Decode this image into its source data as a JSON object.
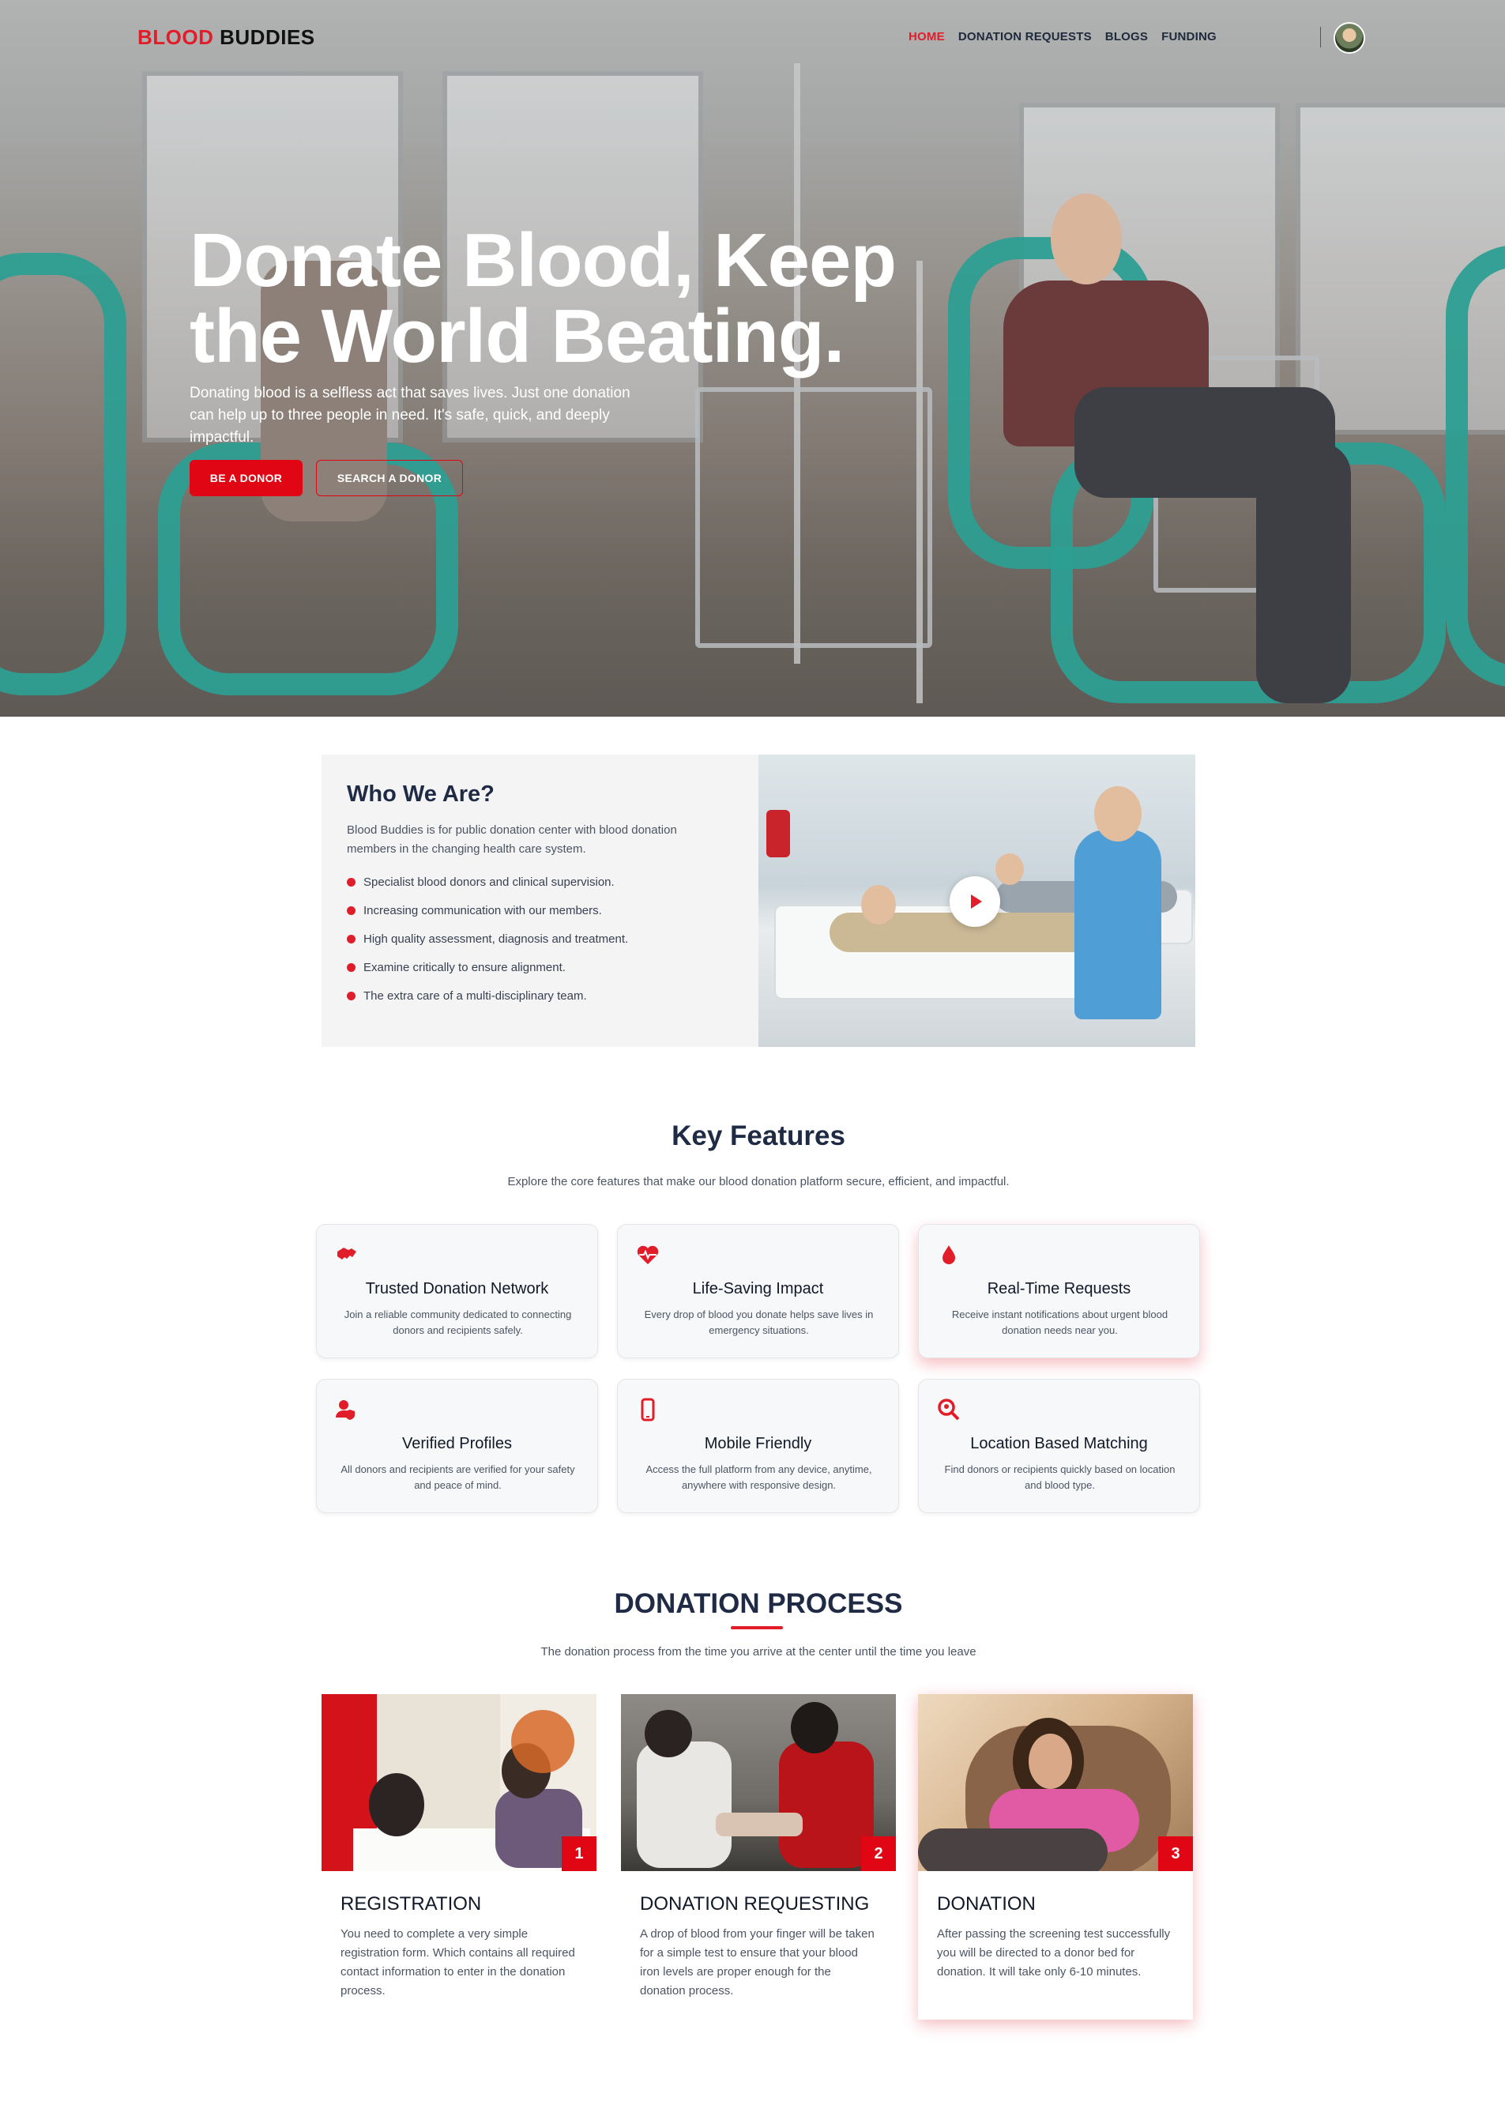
{
  "brand": {
    "part1": "BLOOD",
    "part2": "BUDDIES"
  },
  "nav": {
    "items": [
      "HOME",
      "DONATION REQUESTS",
      "BLOGS",
      "FUNDING"
    ],
    "active": "HOME"
  },
  "hero": {
    "title": "Donate Blood, Keep the World Beating.",
    "subtitle": "Donating blood is a selfless act that saves lives. Just one donation can help up to three people in need. It's safe, quick, and deeply impactful.",
    "primary_button": "BE A DONOR",
    "secondary_button": "SEARCH A DONOR"
  },
  "who": {
    "title": "Who We Are?",
    "description": "Blood Buddies is for public donation center with blood donation members in the changing health care system.",
    "points": [
      "Specialist blood donors and clinical supervision.",
      "Increasing communication with our members.",
      "High quality assessment, diagnosis and treatment.",
      "Examine critically to ensure alignment.",
      "The extra care of a multi-disciplinary team."
    ]
  },
  "features": {
    "title": "Key Features",
    "subtitle": "Explore the core features that make our blood donation platform secure, efficient, and impactful.",
    "cards": [
      {
        "icon": "handshake-icon",
        "title": "Trusted Donation Network",
        "desc": "Join a reliable community dedicated to connecting donors and recipients safely."
      },
      {
        "icon": "heartbeat-icon",
        "title": "Life-Saving Impact",
        "desc": "Every drop of blood you donate helps save lives in emergency situations."
      },
      {
        "icon": "blood-drop-icon",
        "title": "Real-Time Requests",
        "desc": "Receive instant notifications about urgent blood donation needs near you."
      },
      {
        "icon": "user-shield-icon",
        "title": "Verified Profiles",
        "desc": "All donors and recipients are verified for your safety and peace of mind."
      },
      {
        "icon": "mobile-icon",
        "title": "Mobile Friendly",
        "desc": "Access the full platform from any device, anytime, anywhere with responsive design."
      },
      {
        "icon": "search-location-icon",
        "title": "Location Based Matching",
        "desc": "Find donors or recipients quickly based on location and blood type."
      }
    ]
  },
  "process": {
    "title": "DONATION PROCESS",
    "subtitle": "The donation process from the time you arrive at the center until the time you leave",
    "steps": [
      {
        "num": "1",
        "title": "REGISTRATION",
        "desc": "You need to complete a very simple registration form. Which contains all required contact information to enter in the donation process."
      },
      {
        "num": "2",
        "title": "DONATION REQUESTING",
        "desc": "A drop of blood from your finger will be taken for a simple test to ensure that your blood iron levels are proper enough for the donation process."
      },
      {
        "num": "3",
        "title": "DONATION",
        "desc": "After passing the screening test successfully you will be directed to a donor bed for donation. It will take only 6-10 minutes."
      }
    ]
  },
  "colors": {
    "accent": "#e11d2a",
    "heading": "#1f2a44",
    "chair": "#2d9e92"
  }
}
